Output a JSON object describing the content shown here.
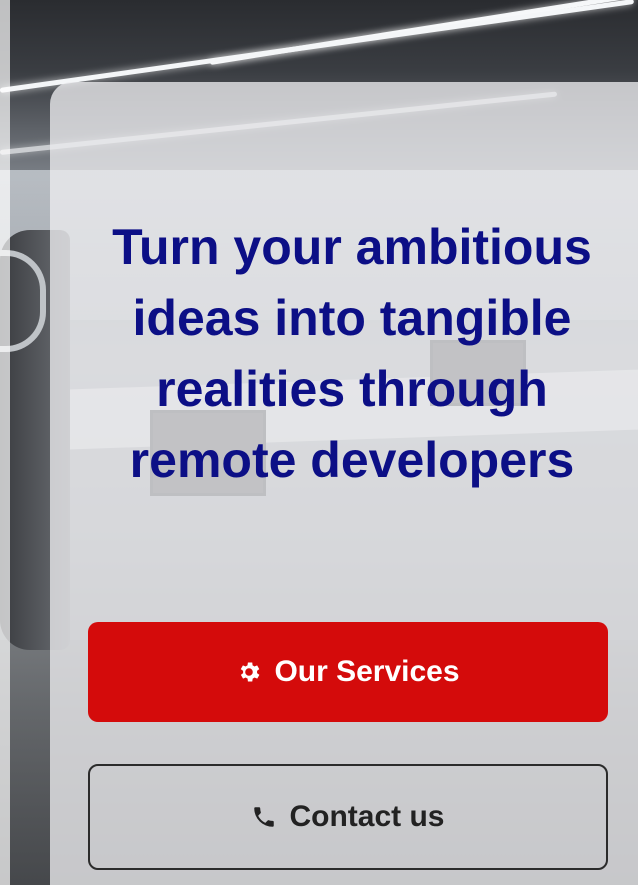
{
  "hero": {
    "headline": "Turn your ambitious ideas into tangible realities through remote developers",
    "accent_color": "#d40b0b",
    "headline_color": "#0c0f86"
  },
  "buttons": {
    "primary": {
      "label": "Our Services",
      "icon": "gear-icon"
    },
    "secondary": {
      "label": "Contact us",
      "icon": "phone-icon"
    }
  }
}
